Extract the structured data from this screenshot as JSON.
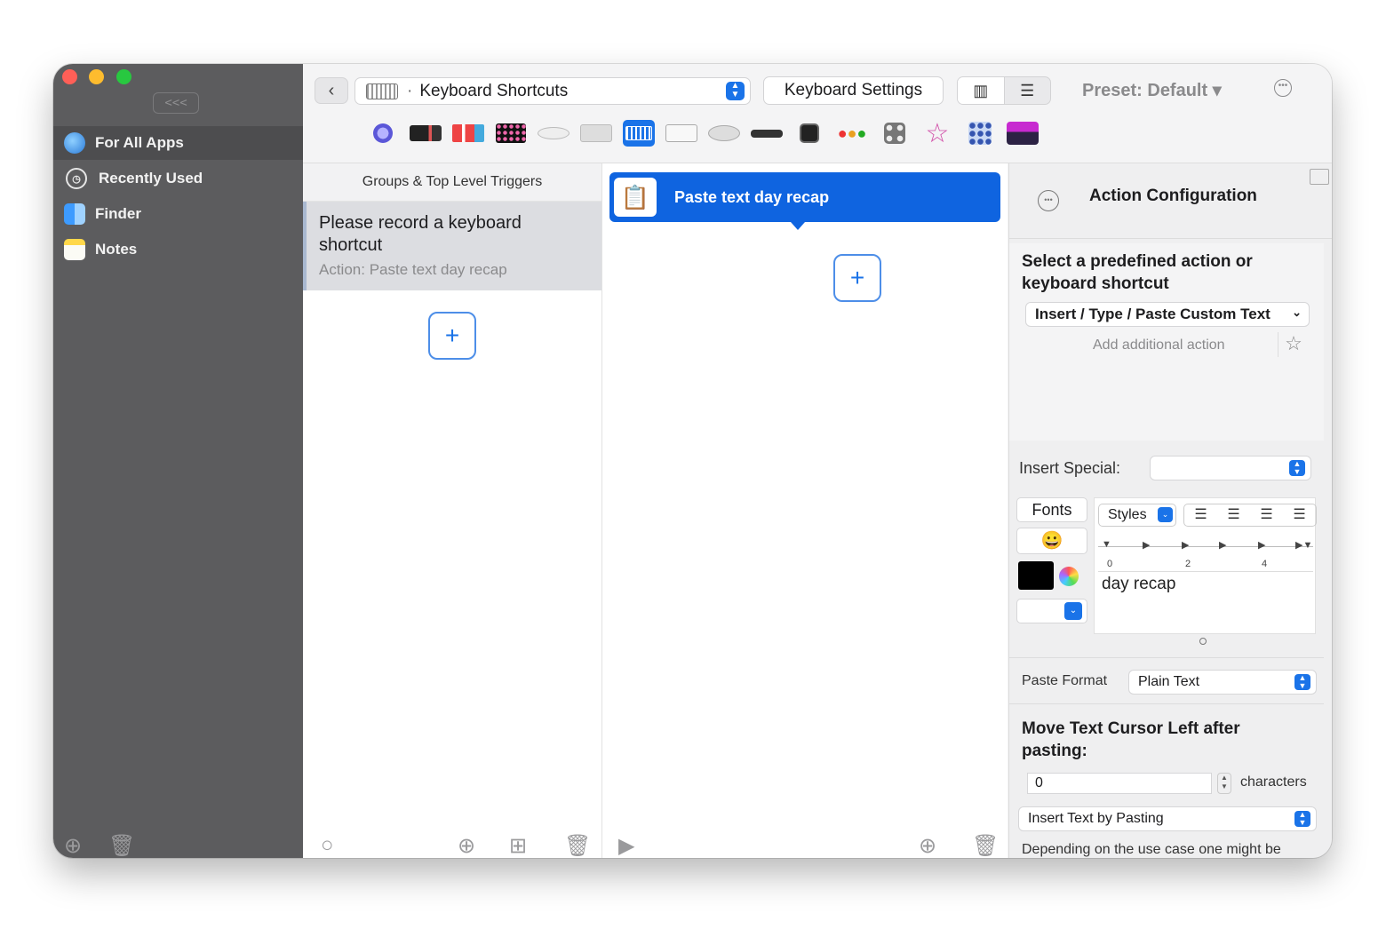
{
  "sidebar": {
    "collapse_label": "<<<",
    "items": [
      {
        "label": "For All Apps",
        "icon": "globe-icon"
      },
      {
        "label": "Recently Used",
        "icon": "clock-icon"
      },
      {
        "label": "Finder",
        "icon": "finder-icon"
      },
      {
        "label": "Notes",
        "icon": "notes-icon"
      }
    ]
  },
  "toolbar": {
    "section_select": "Keyboard Shortcuts",
    "settings_button": "Keyboard Settings",
    "preset": "Preset: Default ▾"
  },
  "groups": {
    "header": "Groups & Top Level Triggers",
    "trigger_title": "Please record a keyboard shortcut",
    "trigger_action": "Action: Paste text day recap"
  },
  "actions": {
    "selected_action": "Paste text day recap"
  },
  "config": {
    "title": "Action Configuration",
    "predefined_heading": "Select a predefined action or keyboard shortcut",
    "predefined_value": "Insert / Type / Paste Custom Text",
    "add_additional": "Add additional action",
    "insert_special_label": "Insert Special:",
    "insert_special_value": "",
    "fonts_button": "Fonts",
    "styles_label": "Styles",
    "ruler_ticks": [
      "0",
      "2",
      "4"
    ],
    "text_content": "day recap",
    "paste_format_label": "Paste Format",
    "paste_format_value": "Plain Text",
    "move_cursor_heading": "Move Text Cursor Left after pasting:",
    "cursor_value": "0",
    "cursor_unit": "characters",
    "insert_method": "Insert Text by Pasting",
    "help_text": "Depending on the use case one might be faster than the other. Also typing works in apps that do not support pasting correctly."
  }
}
